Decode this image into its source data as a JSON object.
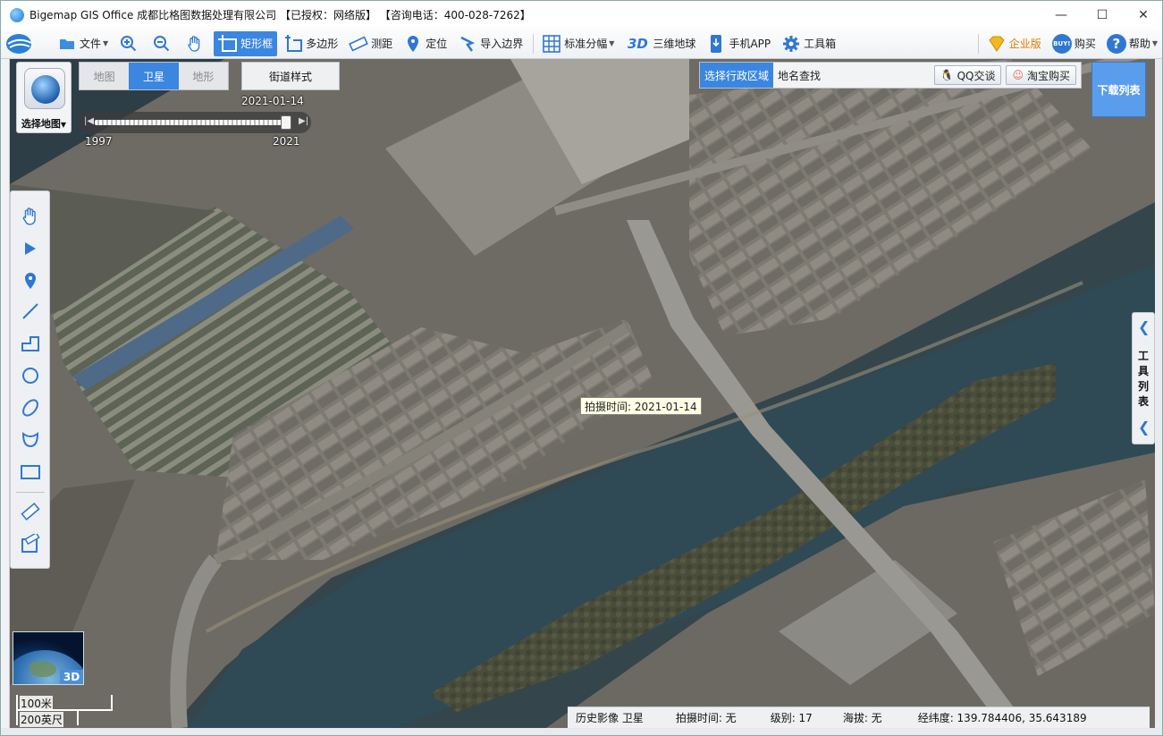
{
  "window": {
    "title": "Bigemap GIS Office 成都比格图数据处理有限公司 【已授权：网络版】 【咨询电话：400-028-7262】",
    "minimize": "—",
    "maximize": "☐",
    "close": "✕"
  },
  "toolbar": {
    "items": [
      {
        "label": "文件",
        "icon": "folder-icon"
      },
      {
        "label": "",
        "icon": "zoom-in-icon"
      },
      {
        "label": "",
        "icon": "zoom-out-icon"
      },
      {
        "label": "",
        "icon": "pan-hand-icon"
      },
      {
        "label": "矩形框",
        "icon": "rectangle-select-icon"
      },
      {
        "label": "多边形",
        "icon": "polygon-icon"
      },
      {
        "label": "测距",
        "icon": "ruler-icon"
      },
      {
        "label": "定位",
        "icon": "location-pin-icon"
      },
      {
        "label": "导入边界",
        "icon": "import-boundary-icon"
      },
      {
        "label": "标准分幅",
        "icon": "grid-icon"
      },
      {
        "label": "三维地球",
        "icon": "3d-icon"
      },
      {
        "label": "手机APP",
        "icon": "phone-icon"
      },
      {
        "label": "工具箱",
        "icon": "gear-icon"
      }
    ],
    "enterprise": "企业版",
    "buy": "购买",
    "help": "帮助",
    "threeD_text": "3D",
    "buy_badge": "BUY!"
  },
  "maptype": {
    "logo_label": "选择地图",
    "tabs": [
      "地图",
      "卫星",
      "地形"
    ],
    "selected": "卫星",
    "street_style": "街道样式",
    "date": "2021-01-14",
    "year_start": "1997",
    "year_end": "2021"
  },
  "search": {
    "tab_region": "选择行政区域",
    "tab_place": "地名查找",
    "qq": "QQ交谈",
    "taobao": "淘宝购买",
    "download_list": "下载列表"
  },
  "drawtools": [
    "pan-hand-icon",
    "select-arrow-icon",
    "marker-icon",
    "line-icon",
    "polyline-icon",
    "circle-icon",
    "ellipse-icon",
    "curve-icon",
    "rectangle-icon",
    "ruler-icon",
    "area-measure-icon"
  ],
  "toollist": {
    "label": "工具列表"
  },
  "tooltip": "拍摄时间: 2021-01-14",
  "minimap": {
    "badge": "3D"
  },
  "scale": {
    "metric": "100米",
    "imperial": "200英尺"
  },
  "status": {
    "layer": "历史影像 卫星",
    "shot_time": "拍摄时间: 无",
    "level": "级别:  17",
    "altitude": "海拔: 无",
    "coords": "经纬度:  139.784406, 35.643189"
  },
  "colors": {
    "accent": "#3b86e0",
    "water": "#2f4a55",
    "land": "#8a8276"
  }
}
